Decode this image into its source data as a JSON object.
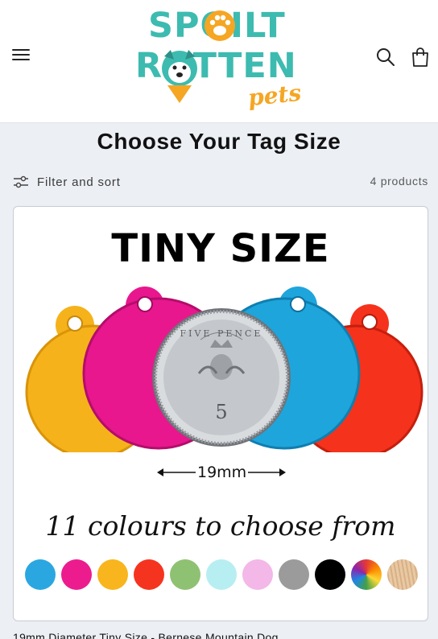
{
  "header": {
    "logo": {
      "line1": "SPOILT",
      "line2": "ROTTEN",
      "line3": "pets"
    },
    "icons": {
      "menu": "menu-icon",
      "search": "search-icon",
      "cart": "cart-icon"
    }
  },
  "collection": {
    "title": "Choose Your Tag Size",
    "filter_label": "Filter and sort",
    "product_count": "4 products"
  },
  "product": {
    "image": {
      "heading": "TINY SIZE",
      "dimension": "19mm",
      "coin_text": "FIVE PENCE",
      "coin_value": "5",
      "colours_line": "11 colours to choose from",
      "swatches": [
        "#2aa7e0",
        "#ec1c8f",
        "#f8b51d",
        "#f5341f",
        "#8fc173",
        "#b7eef2",
        "#f3b7e8",
        "#9b9b9b",
        "#000000",
        "rainbow",
        "wood"
      ],
      "tag_colors": {
        "left": "#f6b21a",
        "pink": "#e8178e",
        "blue": "#1ea5dc",
        "red": "#f5321c"
      }
    },
    "title": "19mm Diameter Tiny Size - Bernese Mountain Dog"
  },
  "colors": {
    "brand_teal": "#3dbbb0",
    "brand_orange": "#f5a623",
    "page_bg": "#eceff4"
  }
}
